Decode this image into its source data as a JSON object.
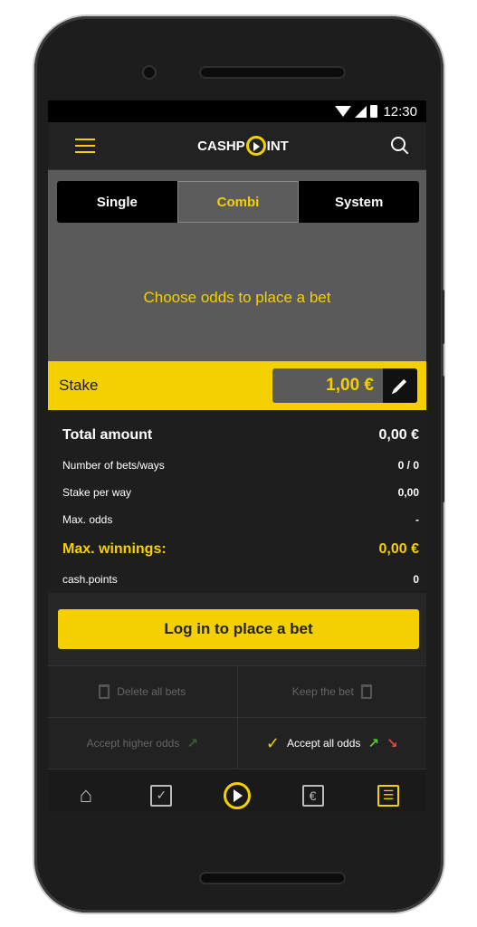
{
  "status_bar": {
    "time": "12:30"
  },
  "app_bar": {
    "logo_text_left": "CASHP",
    "logo_text_right": "INT",
    "menu_icon": "hamburger-icon",
    "search_icon": "search-icon"
  },
  "tabs": [
    {
      "label": "Single",
      "active": false
    },
    {
      "label": "Combi",
      "active": true
    },
    {
      "label": "System",
      "active": false
    }
  ],
  "bet_area": {
    "message": "Choose odds to place a bet"
  },
  "stake": {
    "label": "Stake",
    "value": "1,00 €",
    "edit_icon": "pencil-icon"
  },
  "summary": {
    "total_label": "Total amount",
    "total_value": "0,00 €",
    "bets_label": "Number of bets/ways",
    "bets_value": "0 / 0",
    "stake_way_label": "Stake per way",
    "stake_way_value": "0,00",
    "max_odds_label": "Max. odds",
    "max_odds_value": "-",
    "max_win_label": "Max. winnings:",
    "max_win_value": "0,00 €",
    "cash_points_label": "cash.points",
    "cash_points_value": "0"
  },
  "login_button": "Log in to place a bet",
  "options": {
    "delete_all": "Delete all bets",
    "keep_bet": "Keep the bet",
    "accept_higher": "Accept higher odds",
    "accept_all": "Accept all odds",
    "accept_all_checked": true
  },
  "bottom_nav": [
    {
      "icon": "home-icon"
    },
    {
      "icon": "bet-slip-check-icon"
    },
    {
      "icon": "live-play-icon"
    },
    {
      "icon": "euro-deposit-icon"
    },
    {
      "icon": "list-icon",
      "active": true
    }
  ],
  "colors": {
    "accent": "#f5d000",
    "background": "#262626",
    "odds_up": "#57c73e",
    "odds_down": "#e04b3a"
  }
}
